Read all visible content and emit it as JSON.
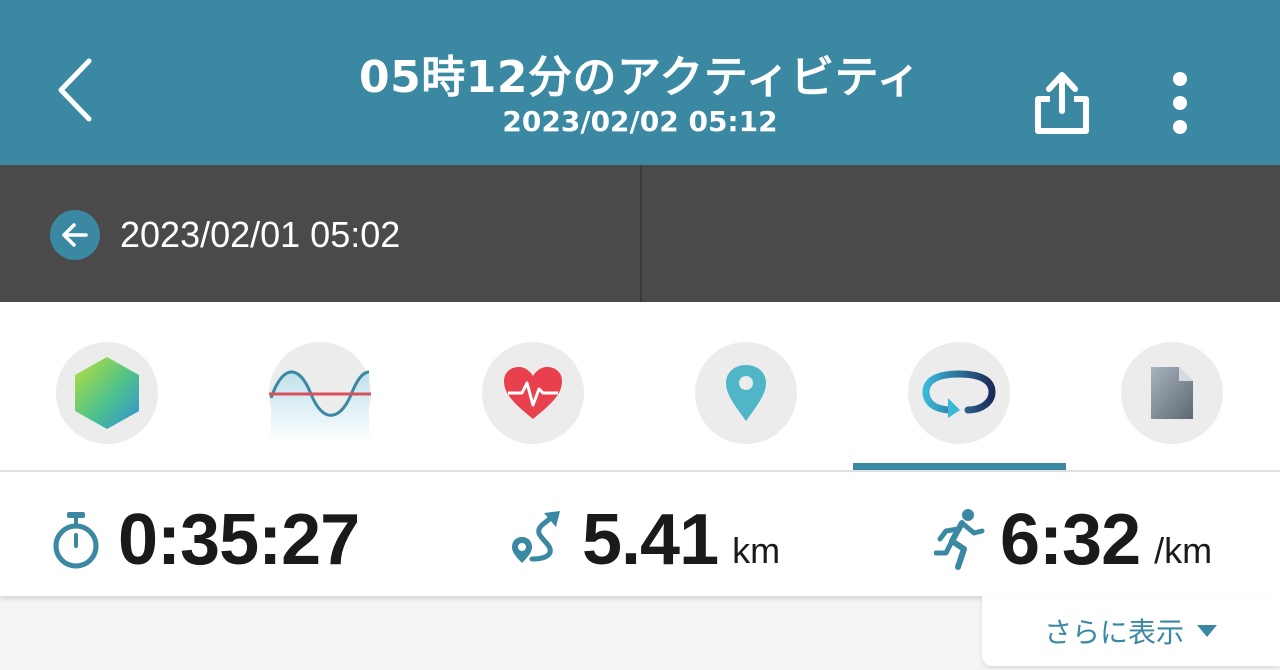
{
  "header": {
    "title": "05時12分のアクティビティ",
    "subtitle": "2023/02/02 05:12",
    "back_icon": "chevron-left-icon",
    "share_icon": "share-icon",
    "more_icon": "more-vertical-icon",
    "background": "#3b88a3"
  },
  "navigation": {
    "previous_activity": "2023/02/01 05:02",
    "previous_icon": "arrow-left-icon",
    "background": "#4a4a4a"
  },
  "tabs": [
    {
      "name": "summary",
      "icon": "hexagon-icon"
    },
    {
      "name": "graph",
      "icon": "wave-graph-icon"
    },
    {
      "name": "heart-rate",
      "icon": "heart-rate-icon"
    },
    {
      "name": "map",
      "icon": "location-pin-icon"
    },
    {
      "name": "laps",
      "icon": "loop-arrow-icon",
      "selected": true
    },
    {
      "name": "file",
      "icon": "document-icon"
    }
  ],
  "stats": {
    "time": {
      "value": "0:35:27",
      "icon": "stopwatch-icon"
    },
    "distance": {
      "value": "5.41",
      "unit": "km",
      "icon": "route-icon"
    },
    "pace": {
      "value": "6:32",
      "unit": "/km",
      "icon": "running-icon"
    }
  },
  "show_more": {
    "label": "さらに表示",
    "icon": "caret-down-icon"
  },
  "colors": {
    "accent": "#3b88a3",
    "heart": "#e8404c",
    "text": "#1a1a1a"
  }
}
